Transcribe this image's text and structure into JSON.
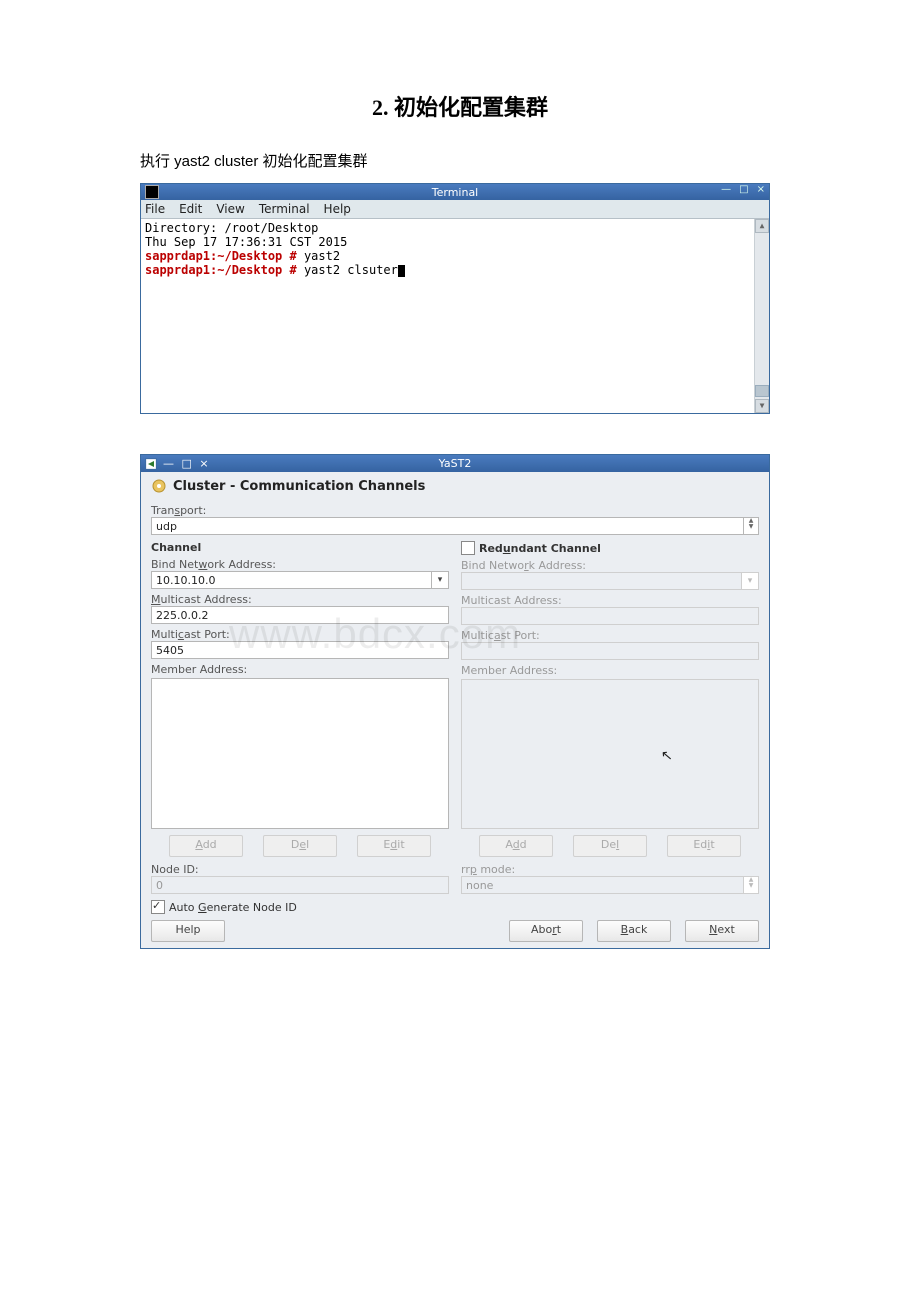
{
  "heading": {
    "num": "2.",
    "text": "初始化配置集群"
  },
  "intro": "执行 yast2 cluster 初始化配置集群",
  "terminal": {
    "title": "Terminal",
    "menu": [
      "File",
      "Edit",
      "View",
      "Terminal",
      "Help"
    ],
    "lines": {
      "l1": "Directory: /root/Desktop",
      "l2": "Thu Sep 17 17:36:31 CST 2015",
      "prompt1": "sapprdap1:~/Desktop #",
      "cmd1": " yast2",
      "prompt2": "sapprdap1:~/Desktop #",
      "cmd2": " yast2 clsuter"
    }
  },
  "yast": {
    "title": "YaST2",
    "header": "Cluster - Communication Channels",
    "transport_label": "Transport:",
    "transport_value": "udp",
    "channel": {
      "title": "Channel",
      "bind_label": "Bind Network Address:",
      "bind_value": "10.10.10.0",
      "mcast_addr_label": "Multicast Address:",
      "mcast_addr_value": "225.0.0.2",
      "mcast_port_label": "Multicast Port:",
      "mcast_port_value": "5405",
      "member_label": "Member Address:",
      "add": "Add",
      "del": "Del",
      "edit": "Edit"
    },
    "redundant": {
      "title": "Redundant Channel",
      "bind_label": "Bind Network Address:",
      "mcast_addr_label": "Multicast Address:",
      "mcast_port_label": "Multicast Port:",
      "member_label": "Member Address:",
      "add": "Add",
      "del": "Del",
      "edit": "Edit"
    },
    "nodeid_label": "Node ID:",
    "nodeid_value": "0",
    "rrp_label": "rrp mode:",
    "rrp_value": "none",
    "auto_label": "Auto Generate Node ID",
    "help": "Help",
    "abort": "Abort",
    "back": "Back",
    "next": "Next"
  },
  "watermark": "www.bdcx.com"
}
